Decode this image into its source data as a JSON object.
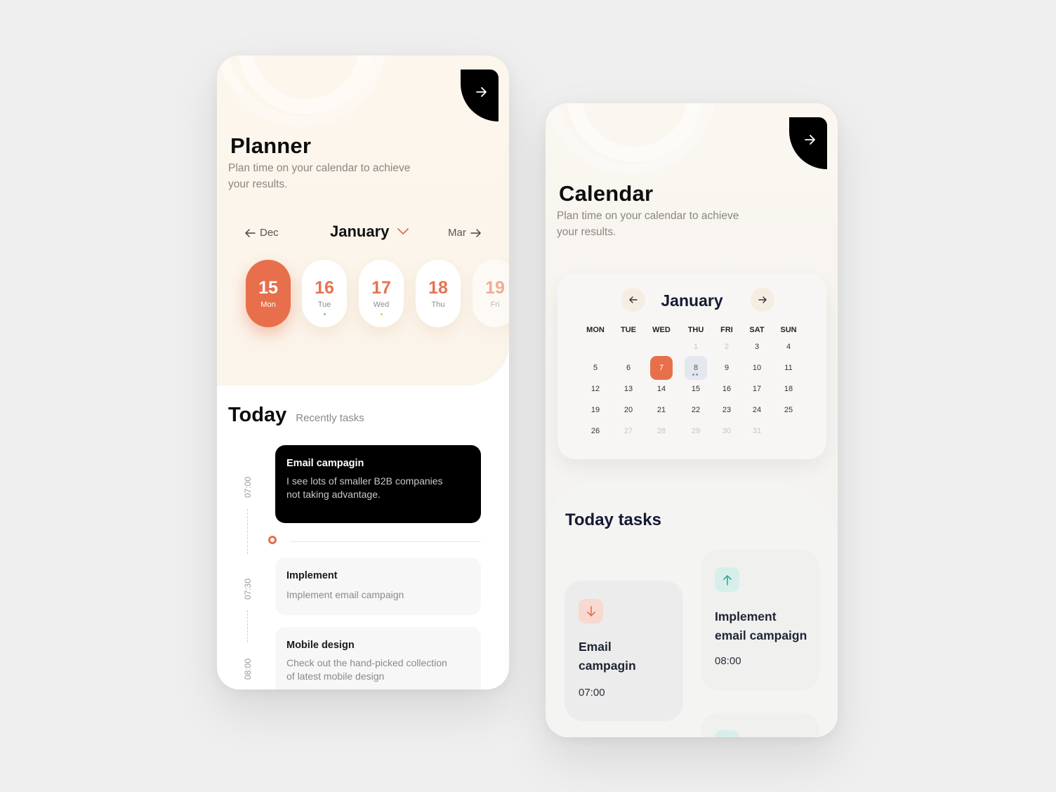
{
  "planner": {
    "title": "Planner",
    "subtitle_line1": "Plan time on your calendar to achieve",
    "subtitle_line2": "your results.",
    "nav": {
      "prev": "Dec",
      "month": "January",
      "next": "Mar"
    },
    "days": [
      {
        "num": "15",
        "name": "Mon",
        "active": true
      },
      {
        "num": "16",
        "name": "Tue",
        "dot": "#5fc4d6"
      },
      {
        "num": "17",
        "name": "Wed",
        "dot": "#f2c04a"
      },
      {
        "num": "18",
        "name": "Thu"
      },
      {
        "num": "19",
        "name": "Fri"
      }
    ],
    "today_title": "Today",
    "today_subtitle": "Recently tasks",
    "times": [
      "07:00",
      "07:30",
      "08:00"
    ],
    "tasks": [
      {
        "title": "Email campagin",
        "desc_line1": "I see lots of smaller B2B companies",
        "desc_line2": "not taking advantage."
      },
      {
        "title": "Implement",
        "desc_line1": "Implement email campaign"
      },
      {
        "title": "Mobile design",
        "desc_line1": "Check out the hand-picked collection",
        "desc_line2": "of latest mobile design"
      }
    ]
  },
  "calendar": {
    "title": "Calendar",
    "subtitle_line1": "Plan time on your calendar to achieve",
    "subtitle_line2": "your results.",
    "month": "January",
    "weekdays": [
      "MON",
      "TUE",
      "WED",
      "THU",
      "FRI",
      "SAT",
      "SUN"
    ],
    "rows": [
      [
        "",
        "",
        "",
        "1",
        "2",
        "3",
        "4"
      ],
      [
        "5",
        "6",
        "7",
        "8",
        "9",
        "10",
        "11"
      ],
      [
        "12",
        "13",
        "14",
        "15",
        "16",
        "17",
        "18"
      ],
      [
        "19",
        "20",
        "21",
        "22",
        "23",
        "24",
        "25"
      ],
      [
        "26",
        "27",
        "28",
        "29",
        "30",
        "31",
        ""
      ]
    ],
    "selected_day": "7",
    "highlighted_day": "8",
    "tasks_title": "Today tasks",
    "tasks": [
      {
        "title_line1": "Email",
        "title_line2": "campagin",
        "time": "07:00",
        "icon": "arrow-down-icon"
      },
      {
        "title_line1": "Implement",
        "title_line2": "email campaign",
        "time": "08:00",
        "icon": "arrow-up-icon"
      }
    ]
  },
  "colors": {
    "accent": "#e76f4b",
    "dark": "#000000",
    "teal": "#3aa79a",
    "cream": "#fbf4ea"
  }
}
